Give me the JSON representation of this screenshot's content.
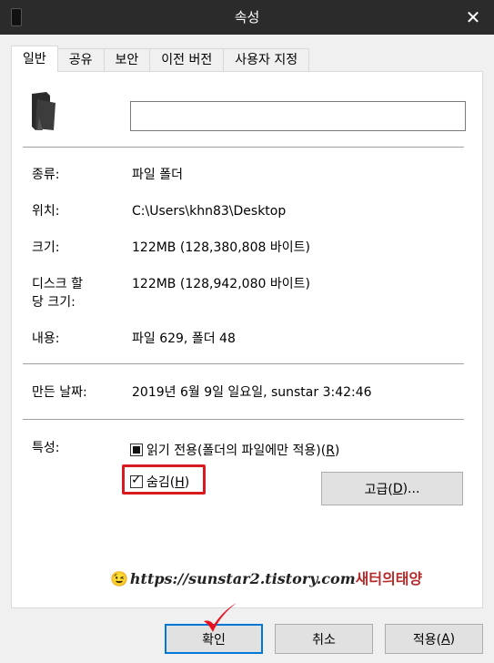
{
  "window": {
    "title": "속성"
  },
  "tabs": [
    {
      "label": "일반"
    },
    {
      "label": "공유"
    },
    {
      "label": "보안"
    },
    {
      "label": "이전 버전"
    },
    {
      "label": "사용자 지정"
    }
  ],
  "general": {
    "name_value": "",
    "type_label": "종류:",
    "type_value": "파일 폴더",
    "location_label": "위치:",
    "location_value": "C:\\Users\\khn83\\Desktop",
    "size_label": "크기:",
    "size_value": "122MB (128,380,808 바이트)",
    "disk_size_label_1": "디스크 할",
    "disk_size_label_2": "당 크기:",
    "disk_size_value": "122MB (128,942,080 바이트)",
    "contents_label": "내용:",
    "contents_value": "파일 629, 폴더 48",
    "created_label": "만든 날짜:",
    "created_value": "2019년 6월 9일 일요일, sunstar 3:42:46",
    "attributes_label": "특성:",
    "readonly_label": "읽기 전용(폴더의 파일에만 적용)(",
    "readonly_key": "R",
    "readonly_end": ")",
    "readonly_state": "indeterminate",
    "hidden_label": "숨김(",
    "hidden_key": "H",
    "hidden_end": ")",
    "hidden_checked": true,
    "advanced_label": "고급(",
    "advanced_key": "D",
    "advanced_end": ")..."
  },
  "watermark": {
    "emoji": "😉",
    "url": "https://sunstar2.tistory.com",
    "korean": "새터의태양"
  },
  "footer": {
    "ok_label": "확인",
    "cancel_label": "취소",
    "apply_label": "적용(",
    "apply_key": "A",
    "apply_end": ")"
  },
  "colors": {
    "titlebar": "#2b2b2b",
    "highlight_red": "#d71920",
    "focus_blue": "#0078d7"
  },
  "icons": {
    "window": "folder-icon",
    "close": "close-icon",
    "folder": "folder-icon",
    "annotation": "red-checkmark-icon"
  }
}
